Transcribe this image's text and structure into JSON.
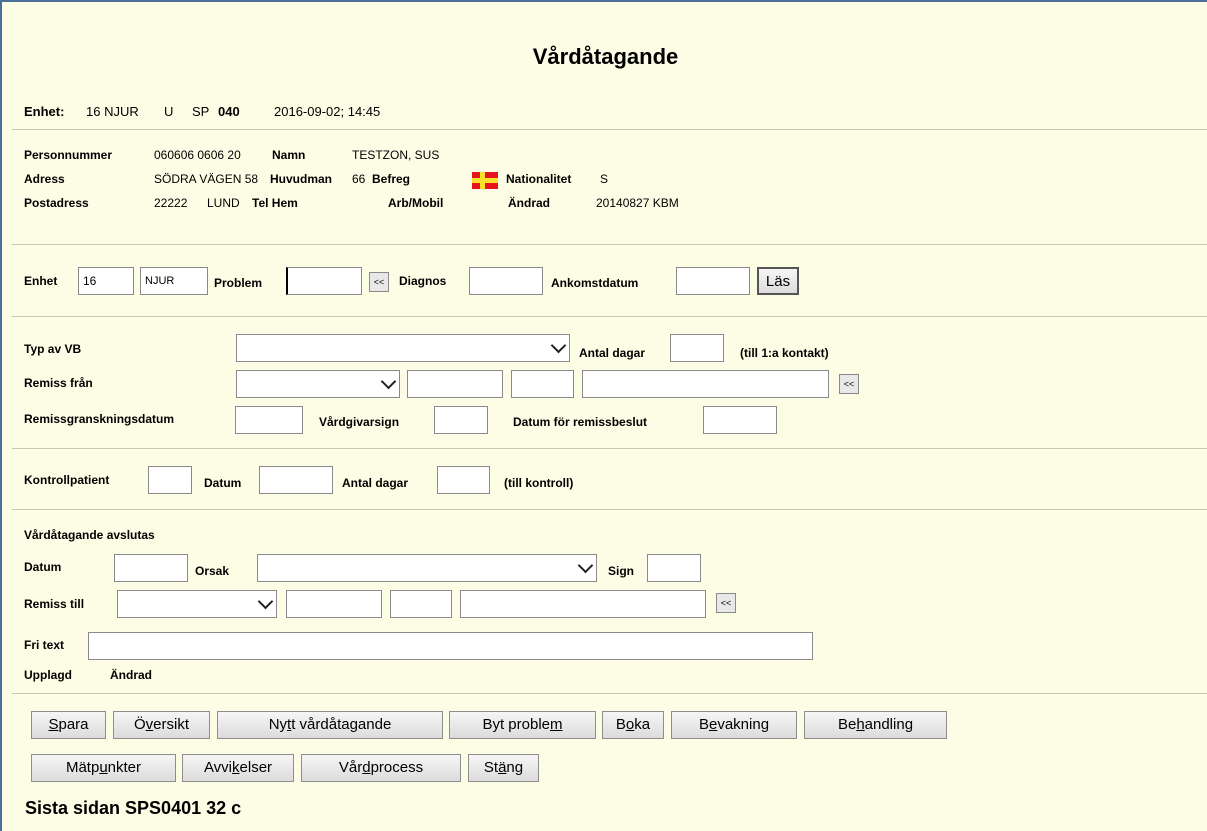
{
  "window": {
    "title": "Vårdåtagande"
  },
  "header": {
    "enhet_label": "Enhet:",
    "enhet_value": "16 NJUR",
    "u": "U",
    "sp_label": "SP",
    "sp_value": "040",
    "datetime": "2016-09-02; 14:45"
  },
  "patient": {
    "personnummer_label": "Personnummer",
    "personnummer_value": "060606 0606  20",
    "namn_label": "Namn",
    "namn_value": "TESTZON, SUS",
    "adress_label": "Adress",
    "adress_value": "SÖDRA VÄGEN 58",
    "huvudman_label": "Huvudman",
    "huvudman_value": "66",
    "befreg_label": "Befreg",
    "nationalitet_label": "Nationalitet",
    "nationalitet_value": "S",
    "postadress_label": "Postadress",
    "postnr": "22222",
    "ort": "LUND",
    "telhem_label": "Tel Hem",
    "arbmobil_label": "Arb/Mobil",
    "andrad_label": "Ändrad",
    "andrad_value": "20140827 KBM"
  },
  "search": {
    "enhet_label": "Enhet",
    "enhet_nr": "16",
    "enhet_namn": "NJUR",
    "problem_label": "Problem",
    "problem_value": "",
    "back_label": "<<",
    "diagnos_label": "Diagnos",
    "diagnos_value": "",
    "ankomstdatum_label": "Ankomstdatum",
    "ankomstdatum_value": "",
    "las_label": "Läs"
  },
  "vb": {
    "typ_label": "Typ av VB",
    "typ_value": "",
    "antal_dagar_label": "Antal dagar",
    "antal_dagar_value": "",
    "till_kontakt": "(till 1:a kontakt)",
    "remiss_fran_label": "Remiss från",
    "back_label": "<<",
    "remissgranskning_label": "Remissgranskningsdatum",
    "vardgivarsign_label": "Vårdgivarsign",
    "remissbeslut_label": "Datum för remissbeslut"
  },
  "kontroll": {
    "kontrollpatient_label": "Kontrollpatient",
    "datum_label": "Datum",
    "antal_dagar_label": "Antal dagar",
    "till_kontroll": "(till kontroll)"
  },
  "avslut": {
    "heading": "Vårdåtagande avslutas",
    "datum_label": "Datum",
    "orsak_label": "Orsak",
    "sign_label": "Sign",
    "remiss_till_label": "Remiss till",
    "back_label": "<<",
    "fritext_label": "Fri text",
    "upplagd_label": "Upplagd",
    "andrad_label": "Ändrad"
  },
  "buttons": {
    "spara": "Spara",
    "oversikt": "Översikt",
    "nytt": "Nytt vårdåtagande",
    "byt_problem": "Byt problem",
    "boka": "Boka",
    "bevakning": "Bevakning",
    "behandling": "Behandling",
    "matpunkter": "Mätpunkter",
    "avvikelser": "Avvikelser",
    "vardprocess": "Vårdprocess",
    "stang": "Stäng"
  },
  "footer": {
    "last_page": "Sista sidan SPS0401 32 c"
  },
  "colors": {
    "background": "#fdfde6",
    "frame": "#4a6f9a",
    "flag_red": "#e8141b",
    "flag_yellow": "#fce22a"
  }
}
